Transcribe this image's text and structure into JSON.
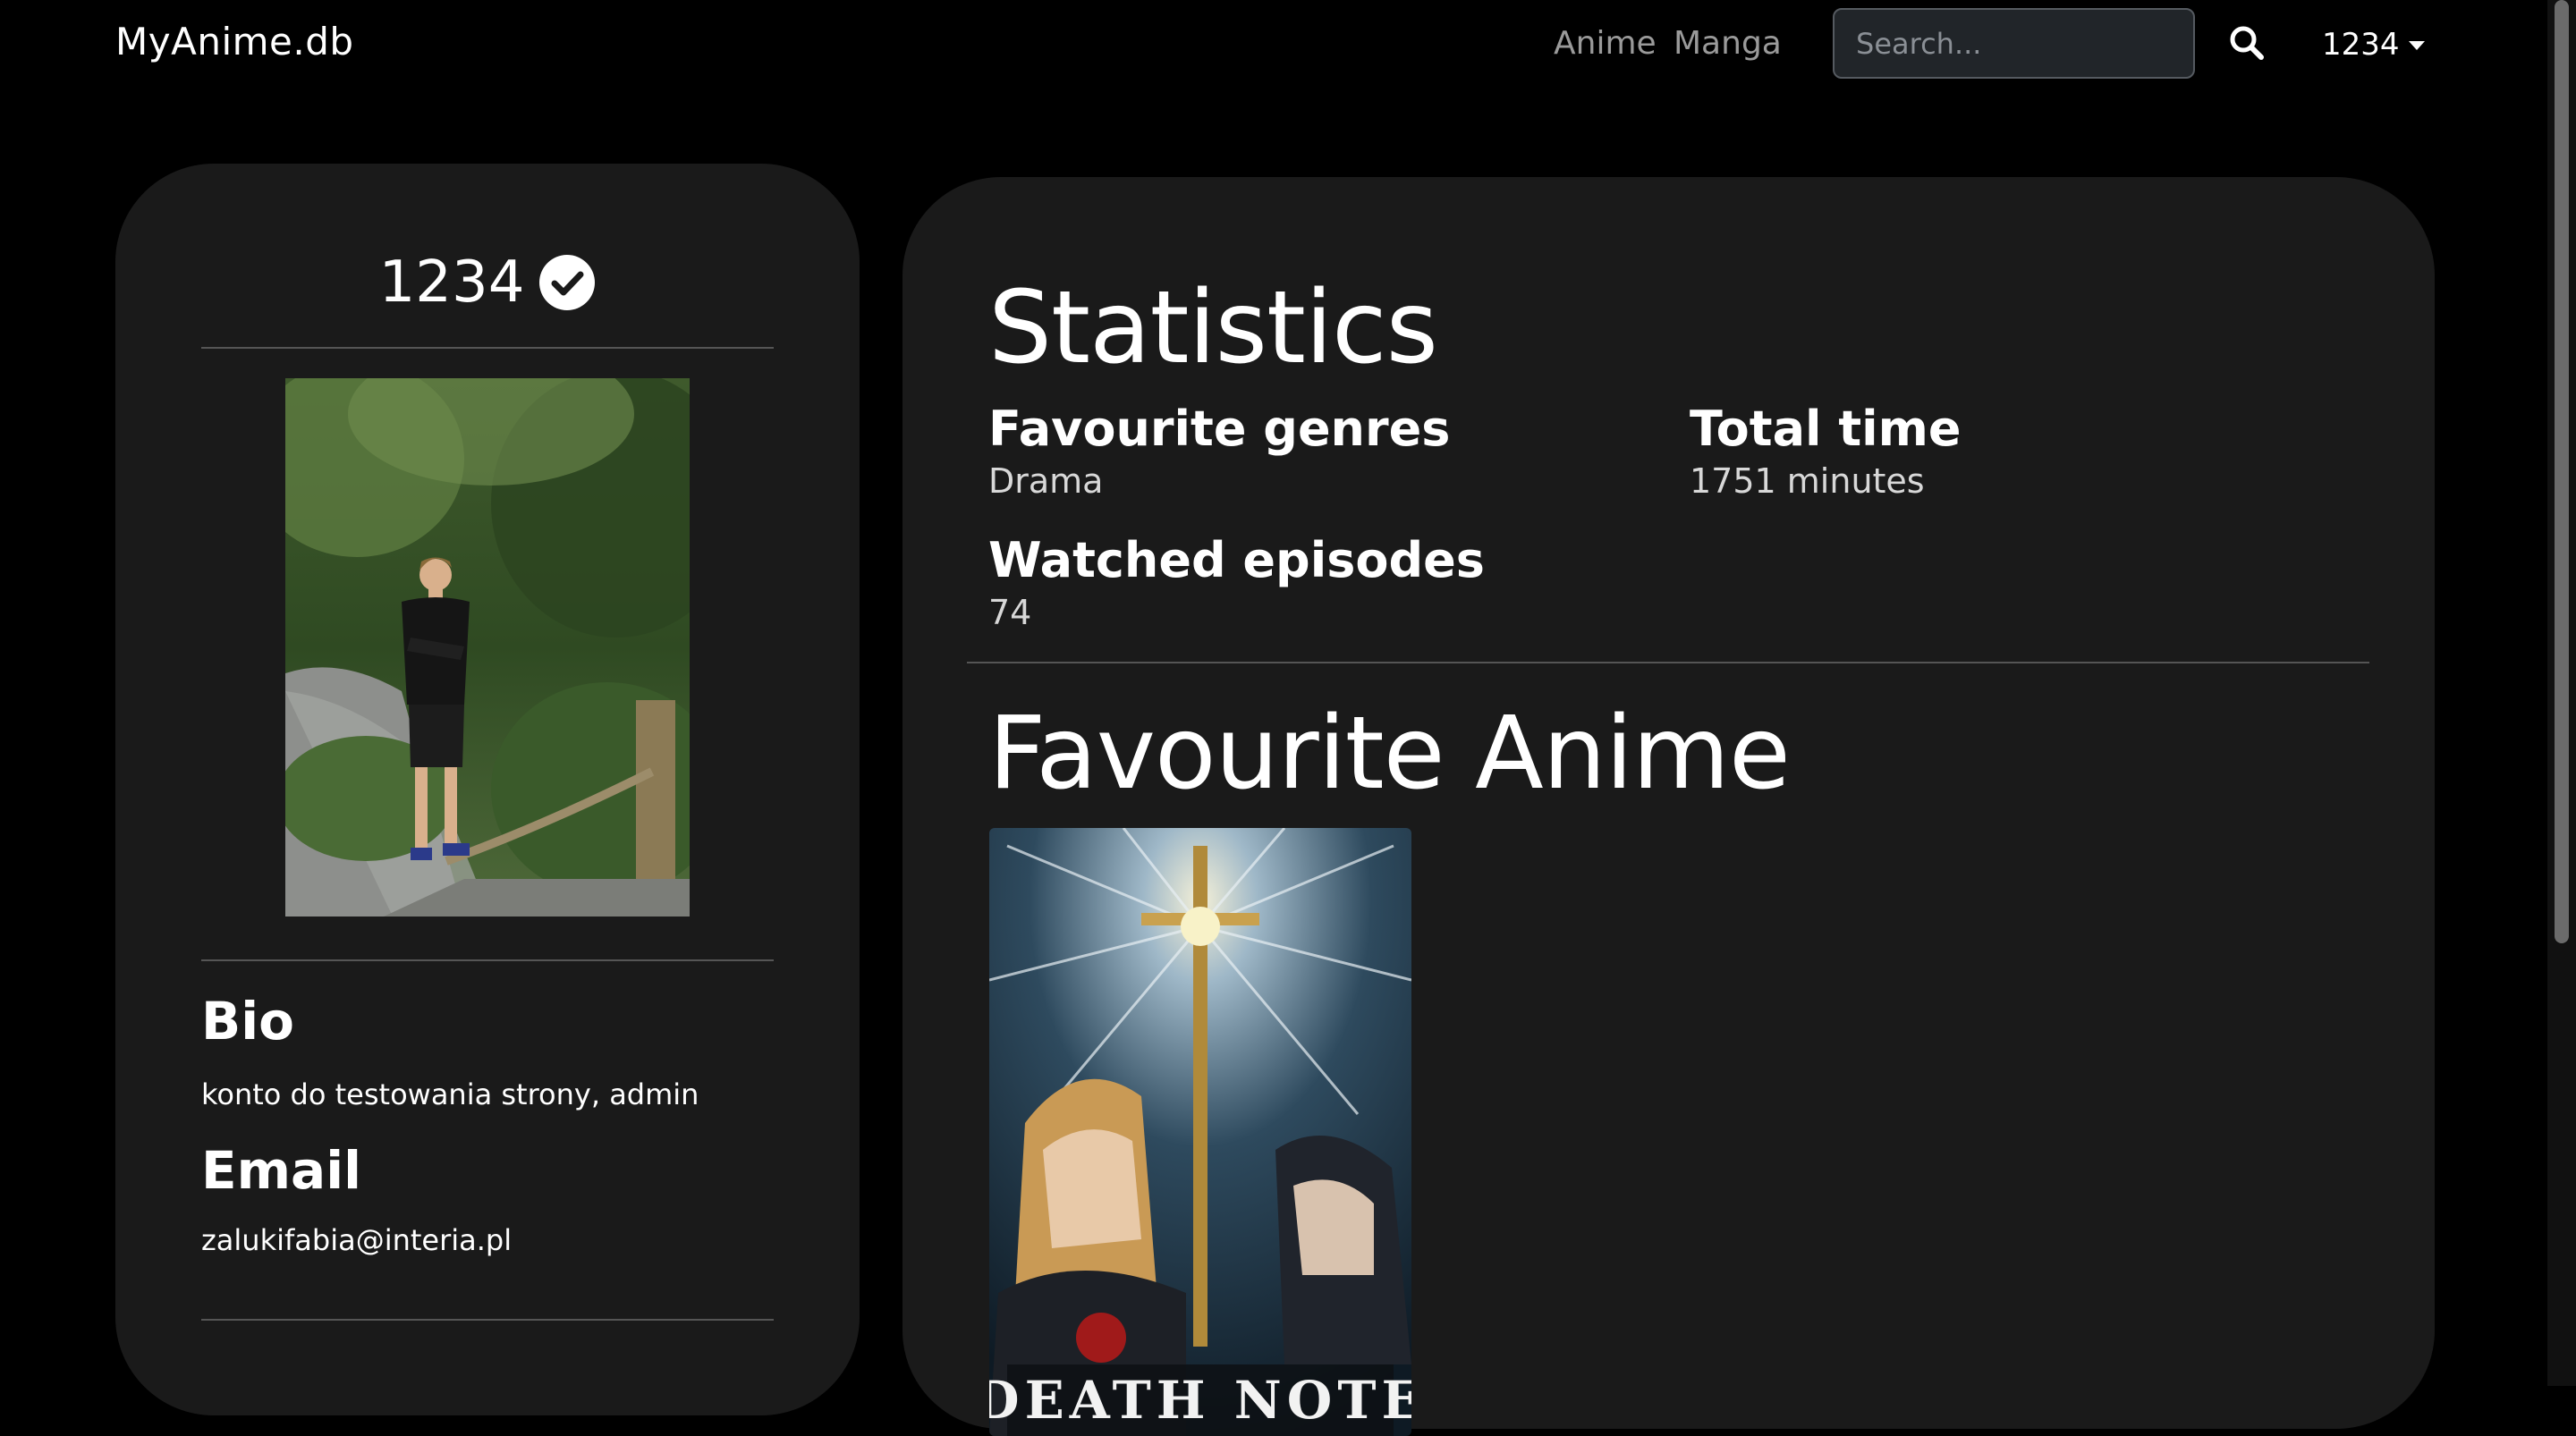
{
  "navbar": {
    "brand": "MyAnime.db",
    "links": [
      "Anime",
      "Manga"
    ],
    "search_placeholder": "Search...",
    "user": "1234"
  },
  "profile": {
    "username": "1234",
    "verified": true,
    "bio_heading": "Bio",
    "bio": "konto do testowania strony, admin",
    "email_heading": "Email",
    "email": "zalukifabia@interia.pl"
  },
  "statistics": {
    "title": "Statistics",
    "favourite_genres_label": "Favourite genres",
    "favourite_genres_value": "Drama",
    "total_time_label": "Total time",
    "total_time_value": "1751 minutes",
    "watched_episodes_label": "Watched episodes",
    "watched_episodes_value": "74"
  },
  "favourites": {
    "title": "Favourite Anime",
    "poster_text": "DEATH NOTE"
  },
  "colors": {
    "page_bg": "#000000",
    "card_bg": "#1a1a1a",
    "nav_link": "#9a9a9a",
    "search_bg": "#212529"
  }
}
